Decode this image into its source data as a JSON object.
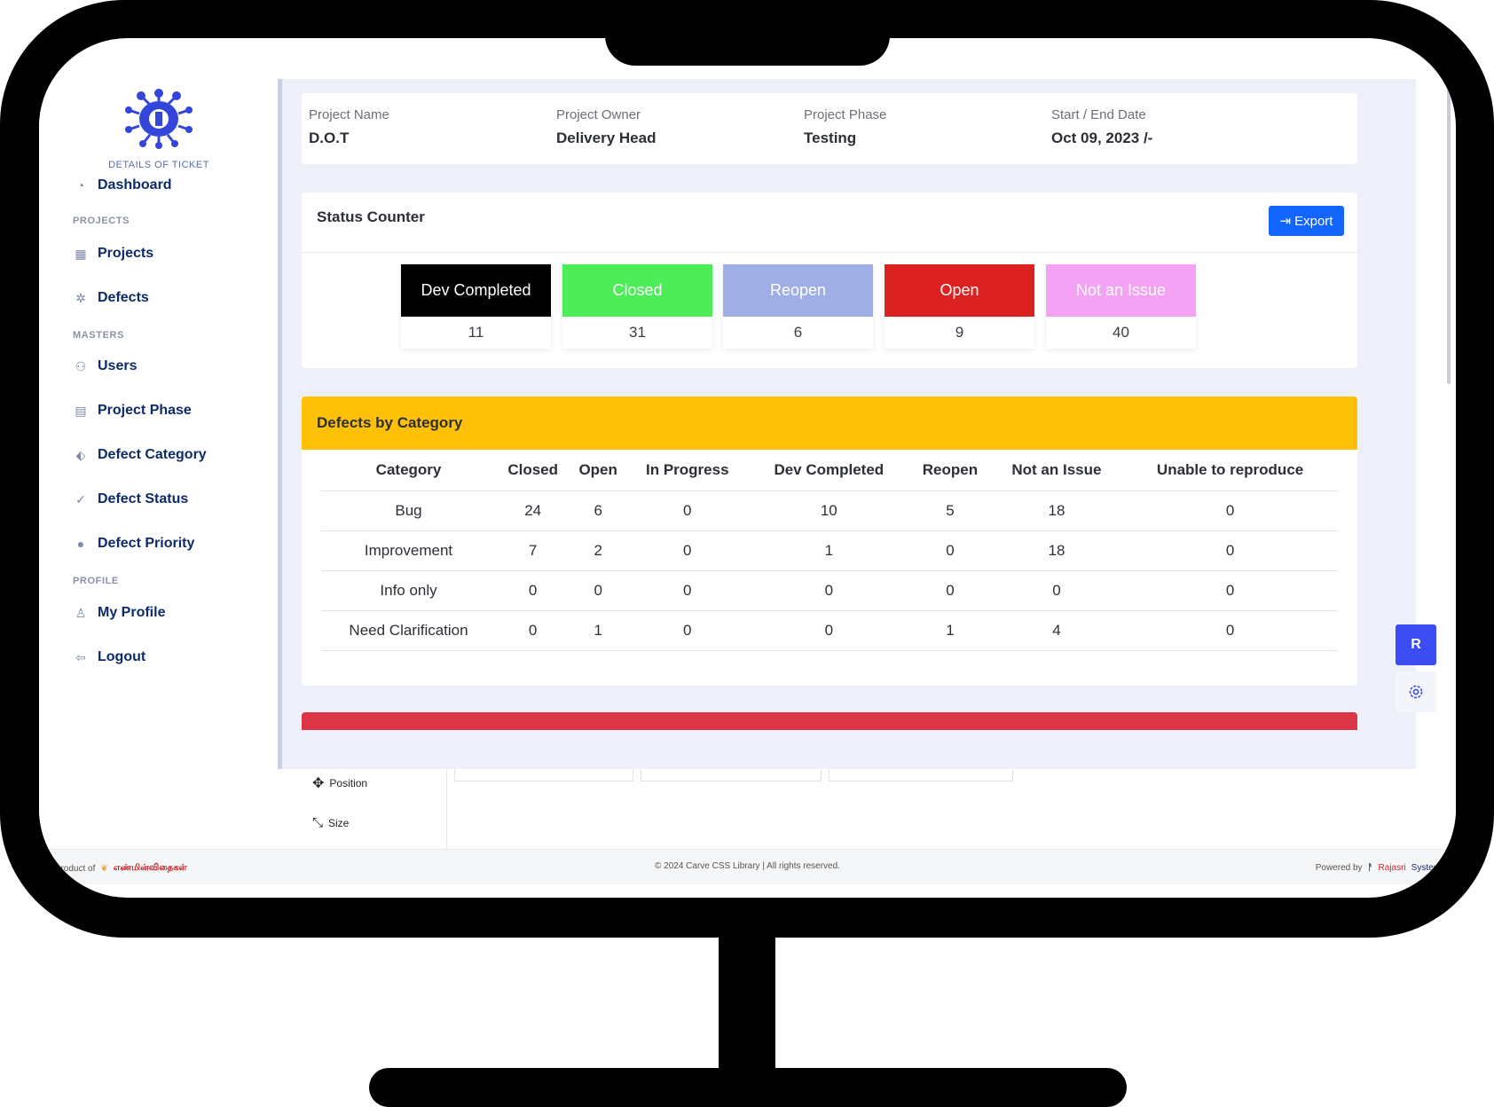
{
  "sidebar": {
    "logo_text": "DETAILS OF TICKET",
    "dashboard": "Dashboard",
    "section_projects": "PROJECTS",
    "projects": "Projects",
    "defects": "Defects",
    "section_masters": "MASTERS",
    "users": "Users",
    "project_phase": "Project Phase",
    "defect_category": "Defect Category",
    "defect_status": "Defect Status",
    "defect_priority": "Defect Priority",
    "section_profile": "PROFILE",
    "my_profile": "My Profile",
    "logout": "Logout"
  },
  "project": {
    "name_label": "Project Name",
    "name_value": "D.O.T",
    "owner_label": "Project Owner",
    "owner_value": "Delivery Head",
    "phase_label": "Project Phase",
    "phase_value": "Testing",
    "date_label": "Start / End Date",
    "date_value": "Oct 09, 2023 /-"
  },
  "status_counter": {
    "title": "Status Counter",
    "export_label": "Export",
    "tiles": [
      {
        "label": "Dev Completed",
        "count": "11",
        "bg": "#000000",
        "fg": "#ffffff"
      },
      {
        "label": "Closed",
        "count": "31",
        "bg": "#4ded5a",
        "fg": "#ffffff"
      },
      {
        "label": "Reopen",
        "count": "6",
        "bg": "#a0aee6",
        "fg": "#ffffff"
      },
      {
        "label": "Open",
        "count": "9",
        "bg": "#dc2121",
        "fg": "#ffffff"
      },
      {
        "label": "Not an Issue",
        "count": "40",
        "bg": "#f4a3f4",
        "fg": "#ffffff"
      }
    ]
  },
  "defects_by_category": {
    "title": "Defects by Category",
    "headers": [
      "Category",
      "Closed",
      "Open",
      "In Progress",
      "Dev Completed",
      "Reopen",
      "Not an Issue",
      "Unable to reproduce"
    ],
    "rows": [
      [
        "Bug",
        "24",
        "6",
        "0",
        "10",
        "5",
        "18",
        "0"
      ],
      [
        "Improvement",
        "7",
        "2",
        "0",
        "1",
        "0",
        "18",
        "0"
      ],
      [
        "Info only",
        "0",
        "0",
        "0",
        "0",
        "0",
        "0",
        "0"
      ],
      [
        "Need Clarification",
        "0",
        "1",
        "0",
        "0",
        "1",
        "4",
        "0"
      ]
    ],
    "header_color": "#ffc107"
  },
  "floating": {
    "avatar_letter": "R"
  },
  "lower_panel": {
    "position_label": "Position",
    "size_label": "Size"
  },
  "footer": {
    "left_prefix": "A product of",
    "left_brand": "எண்மின்விதைகள்",
    "center": "© 2024 Carve CSS Library  |  All rights reserved.",
    "right_prefix": "Powered by",
    "right_brand_a": "Rajasri",
    "right_brand_b": "Systems"
  },
  "colors": {
    "accent": "#1365ff",
    "nav_text": "#0d2b6b",
    "danger_strip": "#dc3545"
  }
}
